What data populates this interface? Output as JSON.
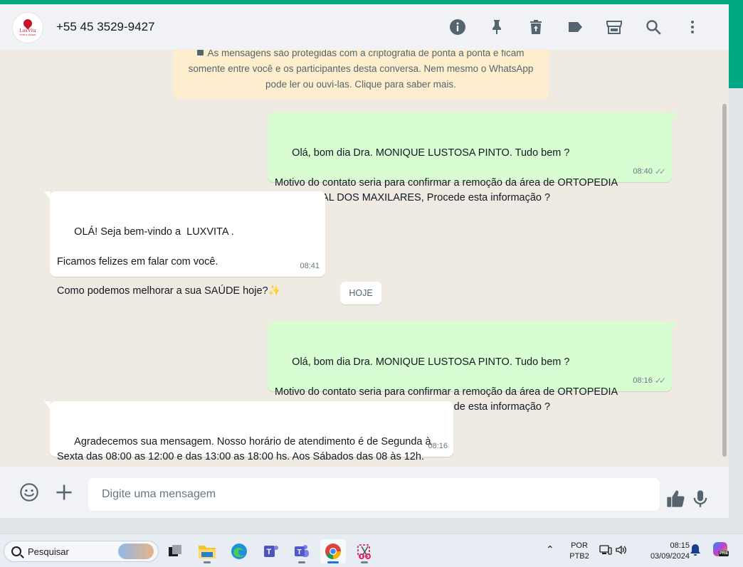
{
  "header": {
    "avatar_name": "LuxVita",
    "avatar_sub": "PORTO VIAGEM",
    "contact": "+55 45 3529-9427"
  },
  "encryption_notice": "As mensagens são protegidas com a criptografia de ponta a ponta e ficam somente entre você e os participantes desta conversa. Nem mesmo o WhatsApp pode ler ou ouvi-las. Clique para saber mais.",
  "messages": [
    {
      "direction": "out",
      "text": "Olá, bom dia Dra. MONIQUE LUSTOSA PINTO. Tudo bem ?\n\nMotivo do contato seria para confirmar a remoção da área de ORTOPEDIA FUNCIONAL DOS MAXILARES, Procede esta informação ?",
      "time": "08:40"
    },
    {
      "direction": "in",
      "text": "OLÁ! Seja bem-vindo a  LUXVITA .\n\nFicamos felizes em falar com você.\n\nComo podemos melhorar a sua SAÚDE hoje?✨",
      "time": "08:41"
    },
    {
      "direction": "out",
      "text": "Olá, bom dia Dra. MONIQUE LUSTOSA PINTO. Tudo bem ?\n\nMotivo do contato seria para confirmar a remoção da área de ORTOPEDIA FUNCIONAL DOS MAXILARES, Procede esta informação ?",
      "time": "08:16"
    },
    {
      "direction": "in",
      "text": "Agradecemos sua mensagem. Nosso horário de atendimento é de Segunda à Sexta das 08:00 as 12:00 e das 13:00 as 18:00 hs. Aos Sábados das 08 às 12h. Responderemos o mais breve possível sua mensagem.",
      "time": "08:16"
    }
  ],
  "date_chip": "HOJE",
  "composer": {
    "placeholder": "Digite uma mensagem"
  },
  "taskbar": {
    "search_label": "Pesquisar",
    "language": "POR",
    "layout": "PTB2",
    "time": "08:15",
    "date": "03/09/2024",
    "copilot_badge": "PRE"
  },
  "colors": {
    "accent": "#00a884",
    "outgoing_bubble": "#d9fdd3",
    "incoming_bubble": "#ffffff",
    "chat_bg": "#efeae2",
    "notice_bg": "#ffeecd"
  }
}
